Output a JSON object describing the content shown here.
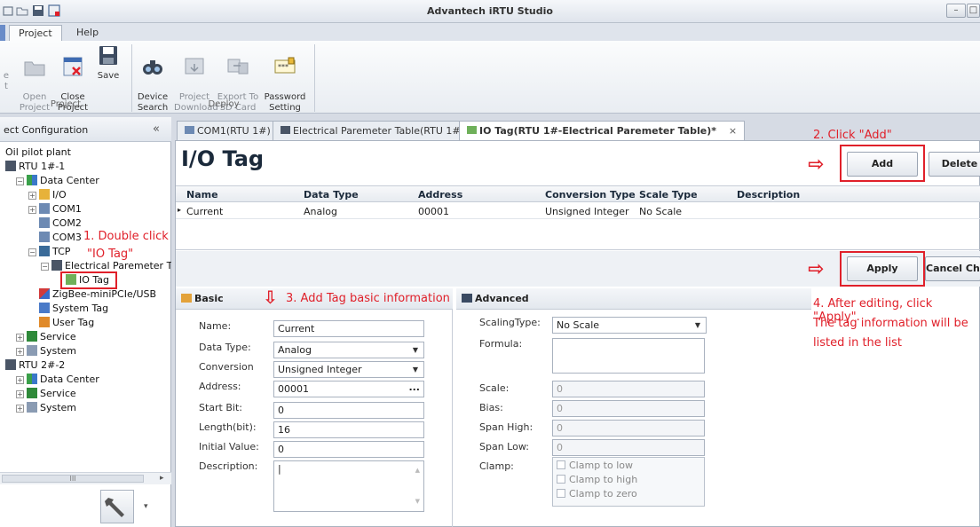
{
  "app_title": "Advantech iRTU Studio",
  "menu": {
    "tabs": [
      "Project",
      "Help"
    ]
  },
  "ribbon": {
    "project_group_label": "Project",
    "deploy_group_label": "Deploy",
    "buttons": {
      "open": "Open\nProject",
      "close": "Close\nProject",
      "save": "Save",
      "device_search": "Device\nSearch",
      "project_download": "Project\nDownload",
      "export_sd": "Export To\nSD Card",
      "password": "Password\nSetting"
    }
  },
  "left_panel": {
    "title": "ect Configuration",
    "collapse": "«",
    "tree": [
      "Oil pilot plant",
      "RTU 1#-1",
      "Data Center",
      "I/O",
      "COM1",
      "COM2",
      "COM3",
      "TCP",
      "Electrical Paremeter Ta",
      "IO Tag",
      "ZigBee-miniPCIe/USB",
      "System Tag",
      "User Tag",
      "Service",
      "System",
      "RTU 2#-2",
      "Data Center",
      "Service",
      "System"
    ],
    "scroll_label": "III"
  },
  "doc_tabs": [
    "COM1(RTU 1#)",
    "Electrical Paremeter Table(RTU 1#)",
    "IO Tag(RTU 1#-Electrical Paremeter Table)*"
  ],
  "page_title": "I/O Tag",
  "buttons": {
    "add": "Add",
    "delete": "Delete",
    "apply": "Apply",
    "cancel": "Cancel Char"
  },
  "table": {
    "headers": [
      "Name",
      "Data Type",
      "Address",
      "Conversion Type",
      "Scale Type",
      "Description"
    ],
    "rows": [
      [
        "Current",
        "Analog",
        "00001",
        "Unsigned Integer",
        "No Scale",
        ""
      ]
    ]
  },
  "basic": {
    "title": "Basic",
    "labels": [
      "Name:",
      "Data Type:",
      "Conversion",
      "Address:",
      "Start Bit:",
      "Length(bit):",
      "Initial Value:",
      "Description:"
    ],
    "values": {
      "name": "Current",
      "data_type": "Analog",
      "conversion": "Unsigned Integer",
      "address": "00001",
      "start_bit": "0",
      "length": "16",
      "initial_value": "0"
    },
    "ellipsis": "..."
  },
  "advanced": {
    "title": "Advanced",
    "labels": [
      "ScalingType:",
      "Formula:",
      "Scale:",
      "Bias:",
      "Span High:",
      "Span Low:",
      "Clamp:"
    ],
    "scaling_type": "No Scale",
    "scale": "0",
    "bias": "0",
    "span_high": "0",
    "span_low": "0",
    "clamp": [
      "Clamp to low",
      "Clamp to high",
      "Clamp to zero"
    ]
  },
  "annotations": {
    "step1a": "1. Double click",
    "step1b": "\"IO Tag\"",
    "step2": "2. Click \"Add\"",
    "step3": "3. Add Tag basic information",
    "step4a": "4. After editing, click \"Apply\".",
    "step4b": "The tag information will be",
    "step4c": "listed in the list"
  },
  "colors": {
    "annotation_red": "#e0202a",
    "title_blue": "#1b2a3b"
  }
}
